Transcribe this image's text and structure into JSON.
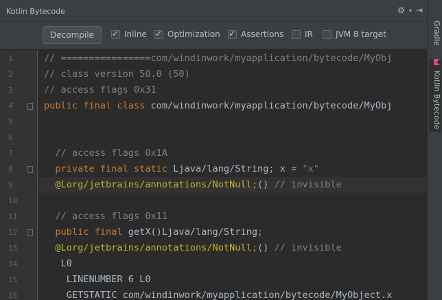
{
  "panel": {
    "title": "Kotlin Bytecode"
  },
  "toolbar": {
    "decompile_label": "Decompile",
    "options": [
      {
        "label": "Inline",
        "checked": true
      },
      {
        "label": "Optimization",
        "checked": true
      },
      {
        "label": "Assertions",
        "checked": true
      },
      {
        "label": "IR",
        "checked": false
      },
      {
        "label": "JVM 8 target",
        "checked": false
      }
    ]
  },
  "side_tabs": [
    {
      "label": "Gradle",
      "icon": "gradle-icon"
    },
    {
      "label": "Kotlin Bytecode",
      "icon": "kotlin-icon",
      "active": true
    }
  ],
  "colors": {
    "comment": "#808080",
    "keyword": "#cc7832",
    "string": "#6a8759",
    "plain": "#a9b7c6",
    "annotation": "#bbb529"
  },
  "code": {
    "line_numbers": [
      "1",
      "2",
      "3",
      "4",
      "5",
      "6",
      "7",
      "8",
      "9",
      "10",
      "11",
      "12",
      "13",
      "14",
      "15",
      "16"
    ],
    "current_line": 9,
    "lines": [
      {
        "tokens": [
          {
            "t": "comment",
            "v": "// ================com/windinwork/myapplication/bytecode/MyObj"
          }
        ]
      },
      {
        "tokens": [
          {
            "t": "comment",
            "v": "// class version 50.0 (50)"
          }
        ]
      },
      {
        "tokens": [
          {
            "t": "comment",
            "v": "// access flags 0x31"
          }
        ]
      },
      {
        "tokens": [
          {
            "t": "keyword",
            "v": "public final class "
          },
          {
            "t": "plain",
            "v": "com/windinwork/myapplication/bytecode/MyObj"
          }
        ]
      },
      {
        "tokens": []
      },
      {
        "tokens": []
      },
      {
        "tokens": [
          {
            "t": "comment",
            "v": "  // access flags 0x1A"
          }
        ]
      },
      {
        "tokens": [
          {
            "t": "keyword",
            "v": "  private final static "
          },
          {
            "t": "plain",
            "v": "Ljava/lang/String; x = "
          },
          {
            "t": "string",
            "v": "\"x\""
          }
        ]
      },
      {
        "tokens": [
          {
            "t": "annotation",
            "v": "  @Lorg/jetbrains/annotations/NotNull"
          },
          {
            "t": "keyword",
            "v": ";"
          },
          {
            "t": "plain",
            "v": "() "
          },
          {
            "t": "comment",
            "v": "// invisible"
          }
        ]
      },
      {
        "tokens": []
      },
      {
        "tokens": [
          {
            "t": "comment",
            "v": "  // access flags 0x11"
          }
        ]
      },
      {
        "tokens": [
          {
            "t": "keyword",
            "v": "  public final "
          },
          {
            "t": "plain",
            "v": "getX()Ljava/lang/String"
          },
          {
            "t": "keyword",
            "v": ";"
          }
        ]
      },
      {
        "tokens": [
          {
            "t": "annotation",
            "v": "  @Lorg/jetbrains/annotations/NotNull"
          },
          {
            "t": "keyword",
            "v": ";"
          },
          {
            "t": "plain",
            "v": "() "
          },
          {
            "t": "comment",
            "v": "// invisible"
          }
        ]
      },
      {
        "tokens": [
          {
            "t": "plain",
            "v": "   L0"
          }
        ]
      },
      {
        "tokens": [
          {
            "t": "plain",
            "v": "    LINENUMBER 6 L0"
          }
        ]
      },
      {
        "tokens": [
          {
            "t": "plain",
            "v": "    GETSTATIC com/windinwork/myapplication/bytecode/MyObject.x"
          }
        ]
      }
    ]
  }
}
